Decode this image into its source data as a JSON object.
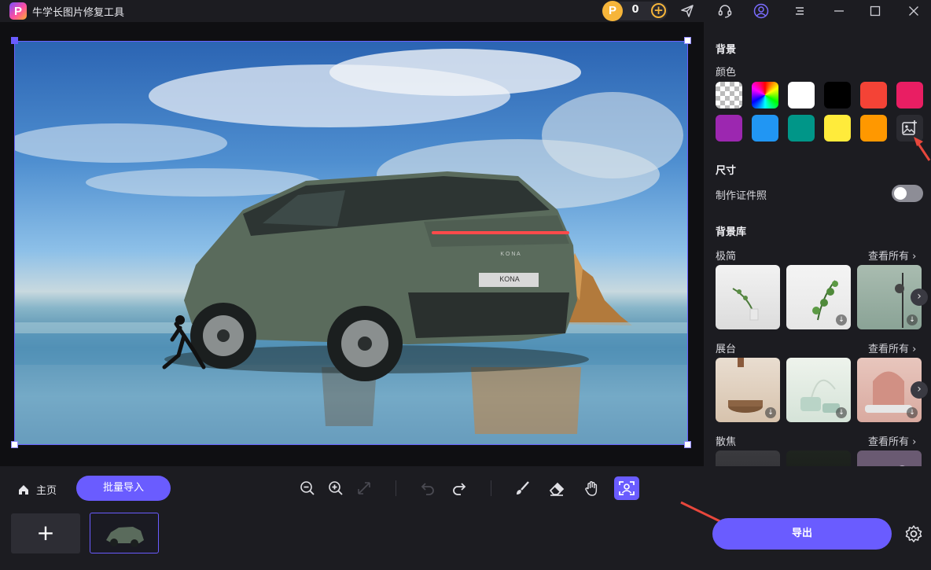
{
  "titlebar": {
    "app_title": "牛学长图片修复工具",
    "logo_letter": "P",
    "coin_letter": "P",
    "coin_count": "0",
    "coin_add": "+",
    "icons": [
      "send-icon",
      "headset-icon",
      "user-icon",
      "menu-icon",
      "minimize-icon",
      "maximize-icon",
      "close-icon"
    ]
  },
  "panel": {
    "background_title": "背景",
    "color_label": "颜色",
    "swatches": [
      "transparent",
      "rainbow",
      "#ffffff",
      "#000000",
      "#f44336",
      "#e91e63",
      "#9c27b0",
      "#2196f3",
      "#009688",
      "#ffeb3b",
      "#ff9800"
    ],
    "size_title": "尺寸",
    "id_photo_label": "制作证件照",
    "id_photo_toggle": "off",
    "library_title": "背景库",
    "categories": [
      {
        "name": "极简",
        "see_all": "查看所有 ›"
      },
      {
        "name": "展台",
        "see_all": "查看所有 ›"
      },
      {
        "name": "散焦",
        "see_all": "查看所有 ›"
      }
    ]
  },
  "canvas": {
    "plate_text": "KONA",
    "brand_text": "K O N A"
  },
  "bottom": {
    "home_label": "主页",
    "batch_label": "批量导入",
    "add_label": "+",
    "export_label": "导出",
    "tools": [
      "zoom-out-icon",
      "zoom-in-icon",
      "fit-icon",
      "undo-icon",
      "redo-icon",
      "brush-icon",
      "eraser-icon",
      "hand-icon",
      "portrait-icon"
    ]
  },
  "colors": {
    "accent": "#6a5cff",
    "panel_bg": "#1c1c21",
    "canvas_bg": "#0f0f12",
    "coin": "#f6b53a",
    "annotation_arrow": "#e8473c"
  }
}
